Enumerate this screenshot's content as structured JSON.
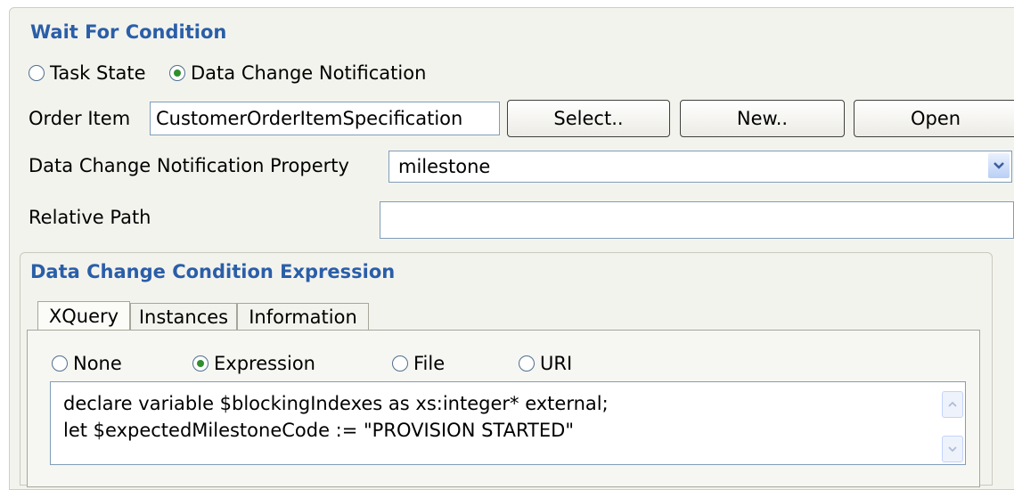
{
  "wait_for_condition": {
    "title": "Wait For Condition",
    "radios": [
      {
        "label": "Task State",
        "checked": false
      },
      {
        "label": "Data Change Notification",
        "checked": true
      }
    ],
    "order_item": {
      "label": "Order Item",
      "value": "CustomerOrderItemSpecification",
      "select_label": "Select..",
      "new_label": "New..",
      "open_label": "Open"
    },
    "property": {
      "label": "Data Change Notification Property",
      "value": "milestone"
    },
    "relative_path": {
      "label": "Relative Path",
      "value": ""
    }
  },
  "expression_section": {
    "title": "Data Change Condition Expression",
    "tabs": [
      {
        "label": "XQuery",
        "active": true
      },
      {
        "label": "Instances",
        "active": false
      },
      {
        "label": "Information",
        "active": false
      }
    ],
    "source_radios": [
      {
        "label": "None",
        "checked": false
      },
      {
        "label": "Expression",
        "checked": true
      },
      {
        "label": "File",
        "checked": false
      },
      {
        "label": "URI",
        "checked": false
      }
    ],
    "code_lines": [
      "declare variable $blockingIndexes as xs:integer* external;",
      "let $expectedMilestoneCode := \"PROVISION STARTED\""
    ]
  },
  "colors": {
    "section_title": "#2a5ea8",
    "panel_bg": "#f3f3ee",
    "radio_selected": "#2f8f2f"
  }
}
